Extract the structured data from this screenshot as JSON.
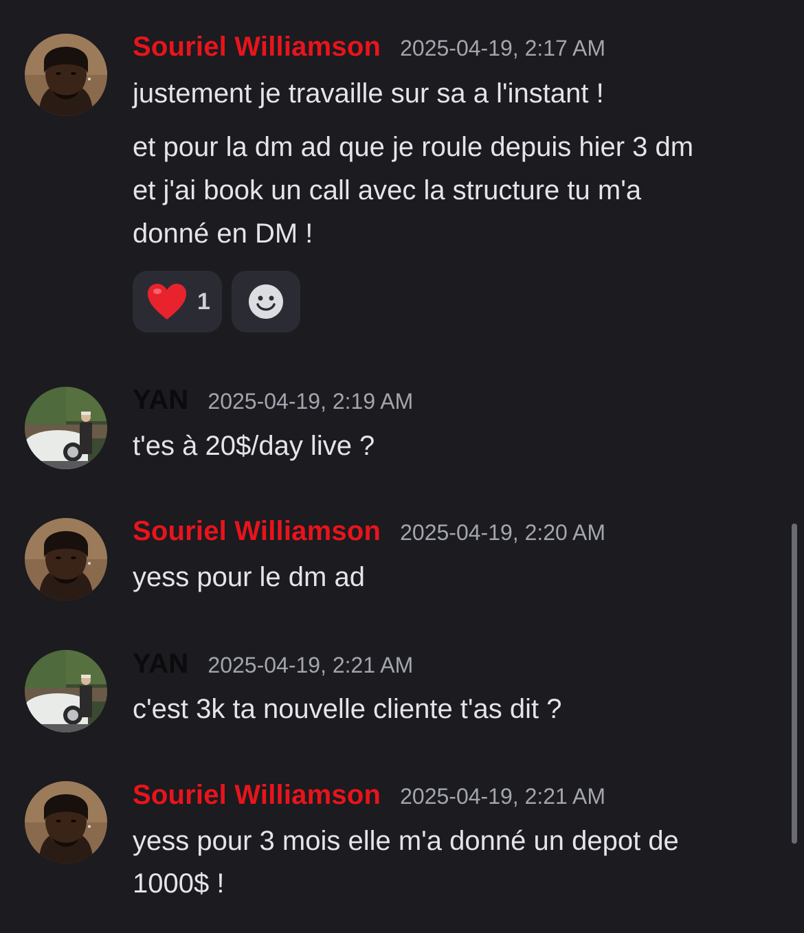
{
  "colors": {
    "background": "#1b1b20",
    "author_souriel": "#e8141b",
    "author_yan": "#0b0b0d",
    "timestamp": "#a3a6ad",
    "reaction_bg": "#2b2c33"
  },
  "messages": [
    {
      "author": "Souriel Williamson",
      "timestamp": "2025-04-19, 2:17 AM",
      "avatar": "souriel-avatar",
      "lines": [
        "justement je travaille sur sa a l'instant !"
      ]
    },
    {
      "continuation": true,
      "lines": [
        "et pour la dm ad que je roule depuis hier 3 dm",
        "et j'ai book un call avec la structure tu m'a",
        "donné en DM !"
      ],
      "reactions": [
        {
          "icon": "heart-emoji",
          "count": "1"
        },
        {
          "icon": "add-reaction-icon"
        }
      ]
    },
    {
      "author": "YAN",
      "timestamp": "2025-04-19, 2:19 AM",
      "avatar": "yan-avatar",
      "lines": [
        "t'es à 20$/day live ?"
      ]
    },
    {
      "author": "Souriel Williamson",
      "timestamp": "2025-04-19, 2:20 AM",
      "avatar": "souriel-avatar",
      "lines": [
        "yess pour le dm ad"
      ]
    },
    {
      "author": "YAN",
      "timestamp": "2025-04-19, 2:21 AM",
      "avatar": "yan-avatar",
      "lines": [
        "c'est 3k ta nouvelle cliente t'as dit ?"
      ]
    },
    {
      "author": "Souriel Williamson",
      "timestamp": "2025-04-19, 2:21 AM",
      "avatar": "souriel-avatar",
      "lines": [
        "yess pour 3 mois elle m'a donné un depot de",
        "1000$ !"
      ]
    }
  ]
}
